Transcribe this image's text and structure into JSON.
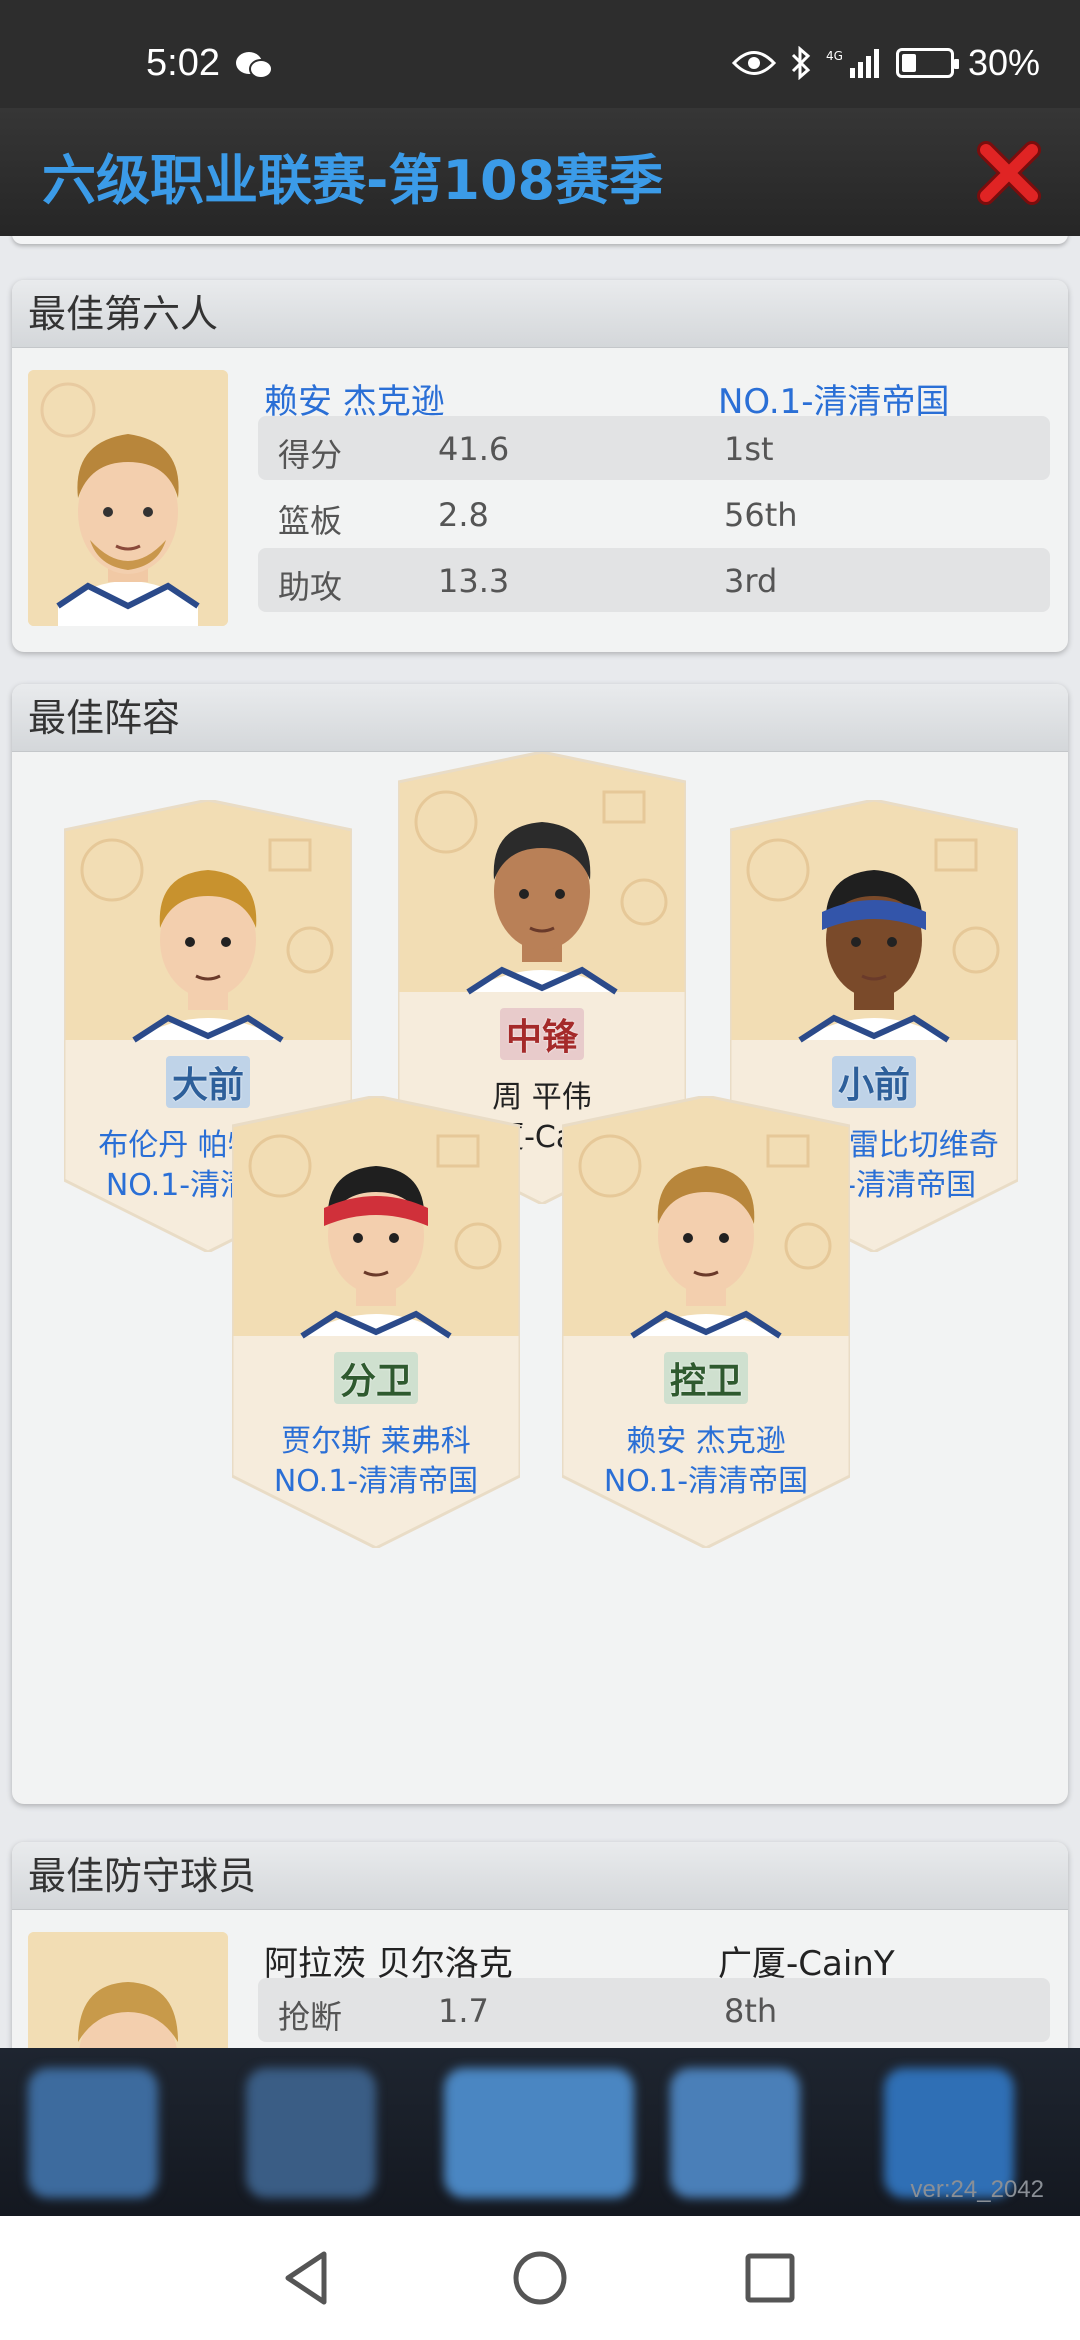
{
  "status": {
    "time": "5:02",
    "battery": "30%",
    "network": "4G",
    "battery_fraction": 0.3
  },
  "header": {
    "title": "六级职业联赛-第108赛季"
  },
  "sixth_man": {
    "title": "最佳第六人",
    "player": "赖安 杰克逊",
    "team": "NO.1-清清帝国",
    "stats": [
      {
        "label": "得分",
        "value": "41.6",
        "rank": "1st"
      },
      {
        "label": "篮板",
        "value": "2.8",
        "rank": "56th"
      },
      {
        "label": "助攻",
        "value": "13.3",
        "rank": "3rd"
      }
    ]
  },
  "lineup": {
    "title": "最佳阵容",
    "cards": [
      {
        "position": "大前",
        "player": "布伦丹 帕特里奇",
        "team": "NO.1-清清帝国"
      },
      {
        "position": "中锋",
        "player": "周 平伟",
        "team": "广厦-CainY"
      },
      {
        "position": "小前",
        "player": "费恩 格雷比切维奇",
        "team": "NO.1-清清帝国"
      },
      {
        "position": "分卫",
        "player": "贾尔斯 莱弗科",
        "team": "NO.1-清清帝国"
      },
      {
        "position": "控卫",
        "player": "赖安 杰克逊",
        "team": "NO.1-清清帝国"
      }
    ]
  },
  "defender": {
    "title": "最佳防守球员",
    "player": "阿拉茨 贝尔洛克",
    "team": "广厦-CainY",
    "stats": [
      {
        "label": "抢断",
        "value": "1.7",
        "rank": "8th"
      }
    ]
  },
  "footer": {
    "version": "ver:24_2042"
  }
}
